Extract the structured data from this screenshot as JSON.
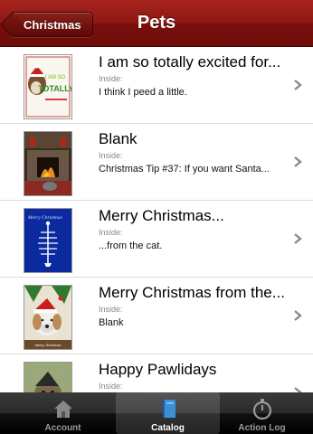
{
  "nav": {
    "back_label": "Christmas",
    "title": "Pets"
  },
  "rows": [
    {
      "title": "I am so totally excited for...",
      "label": "Inside:",
      "subtitle": "I think I peed a little.",
      "card_text_1": "I AM SO",
      "card_text_2": "TOTALLY"
    },
    {
      "title": "Blank",
      "label": "Inside:",
      "subtitle": "Christmas Tip #37: If you want Santa..."
    },
    {
      "title": "Merry Christmas...",
      "label": "Inside:",
      "subtitle": "...from the cat.",
      "card_text": "Merry Christmas"
    },
    {
      "title": "Merry Christmas from the...",
      "label": "Inside:",
      "subtitle": "Blank",
      "card_text": "merry christmas"
    },
    {
      "title": "Happy Pawlidays",
      "label": "Inside:",
      "subtitle": ""
    }
  ],
  "tabs": [
    {
      "label": "Account",
      "icon": "house-icon",
      "selected": false
    },
    {
      "label": "Catalog",
      "icon": "book-icon",
      "selected": true
    },
    {
      "label": "Action Log",
      "icon": "stopwatch-icon",
      "selected": false
    }
  ],
  "colors": {
    "nav_red": "#8e1712",
    "tab_selected_icon": "#3d8fd8"
  }
}
